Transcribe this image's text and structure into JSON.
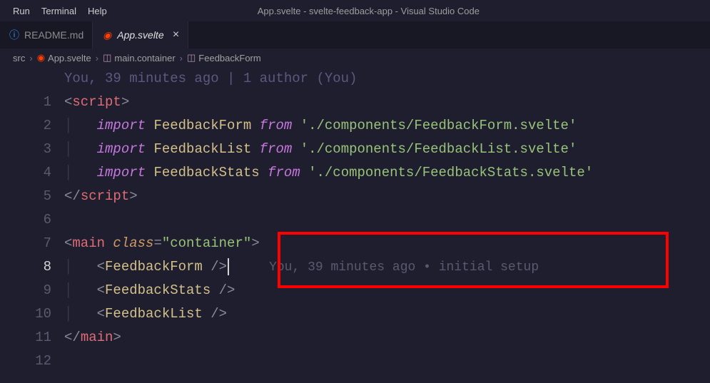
{
  "menu": {
    "run": "Run",
    "terminal": "Terminal",
    "help": "Help"
  },
  "window_title": "App.svelte - svelte-feedback-app - Visual Studio Code",
  "tabs": [
    {
      "label": "README.md",
      "icon": "info"
    },
    {
      "label": "App.svelte",
      "icon": "svelte",
      "active": true
    }
  ],
  "breadcrumbs": {
    "root": "src",
    "file": "App.svelte",
    "container": "main.container",
    "symbol": "FeedbackForm"
  },
  "codelens": "You, 39 minutes ago | 1 author (You)",
  "blame": "You, 39 minutes ago • initial setup",
  "code": {
    "script_open": "script",
    "script_close": "script",
    "import_kw": "import",
    "from_kw": "from",
    "imp1_name": "FeedbackForm",
    "imp1_path": "'./components/FeedbackForm.svelte'",
    "imp2_name": "FeedbackList",
    "imp2_path": "'./components/FeedbackList.svelte'",
    "imp3_name": "FeedbackStats",
    "imp3_path": "'./components/FeedbackStats.svelte'",
    "main_tag": "main",
    "class_attr": "class",
    "class_val": "\"container\"",
    "comp1": "FeedbackForm",
    "comp2": "FeedbackStats",
    "comp3": "FeedbackList"
  },
  "line_numbers": [
    "1",
    "2",
    "3",
    "4",
    "5",
    "6",
    "7",
    "8",
    "9",
    "10",
    "11",
    "12"
  ]
}
